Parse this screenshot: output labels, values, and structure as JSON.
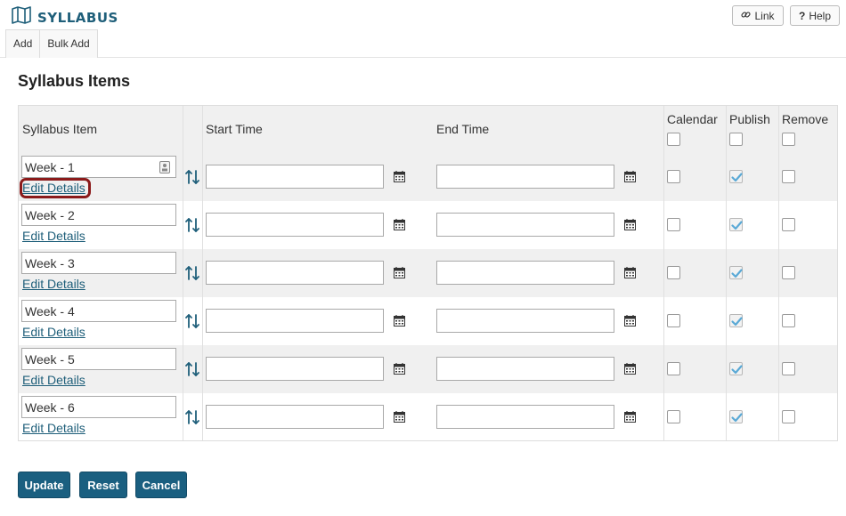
{
  "header": {
    "title": "SYLLABUS",
    "link_label": "Link",
    "help_label": "Help",
    "tabs": [
      {
        "label": "Add"
      },
      {
        "label": "Bulk Add"
      }
    ]
  },
  "section_title": "Syllabus Items",
  "columns": {
    "item": "Syllabus Item",
    "start": "Start Time",
    "end": "End Time",
    "calendar": "Calendar",
    "publish": "Publish",
    "remove": "Remove"
  },
  "rows": [
    {
      "name": "Week - 1",
      "edit_label": "Edit Details",
      "start_value": "",
      "end_value": "",
      "calendar": false,
      "publish": true,
      "remove": false,
      "highlighted": true
    },
    {
      "name": "Week - 2",
      "edit_label": "Edit Details",
      "start_value": "",
      "end_value": "",
      "calendar": false,
      "publish": true,
      "remove": false
    },
    {
      "name": "Week - 3",
      "edit_label": "Edit Details",
      "start_value": "",
      "end_value": "",
      "calendar": false,
      "publish": true,
      "remove": false
    },
    {
      "name": "Week - 4",
      "edit_label": "Edit Details",
      "start_value": "",
      "end_value": "",
      "calendar": false,
      "publish": true,
      "remove": false
    },
    {
      "name": "Week - 5",
      "edit_label": "Edit Details",
      "start_value": "",
      "end_value": "",
      "calendar": false,
      "publish": true,
      "remove": false
    },
    {
      "name": "Week - 6",
      "edit_label": "Edit Details",
      "start_value": "",
      "end_value": "",
      "calendar": false,
      "publish": true,
      "remove": false
    }
  ],
  "actions": {
    "update": "Update",
    "reset": "Reset",
    "cancel": "Cancel"
  },
  "colors": {
    "brand": "#1f5f7a",
    "button": "#1a5f80",
    "highlight": "#8b1a1a",
    "check": "#5aa9d6"
  },
  "icons": {
    "logo": "map-icon",
    "link": "link-icon",
    "help": "question-icon",
    "sort": "sort-arrows-icon",
    "calendar": "calendar-icon",
    "badge": "contact-badge-icon"
  }
}
